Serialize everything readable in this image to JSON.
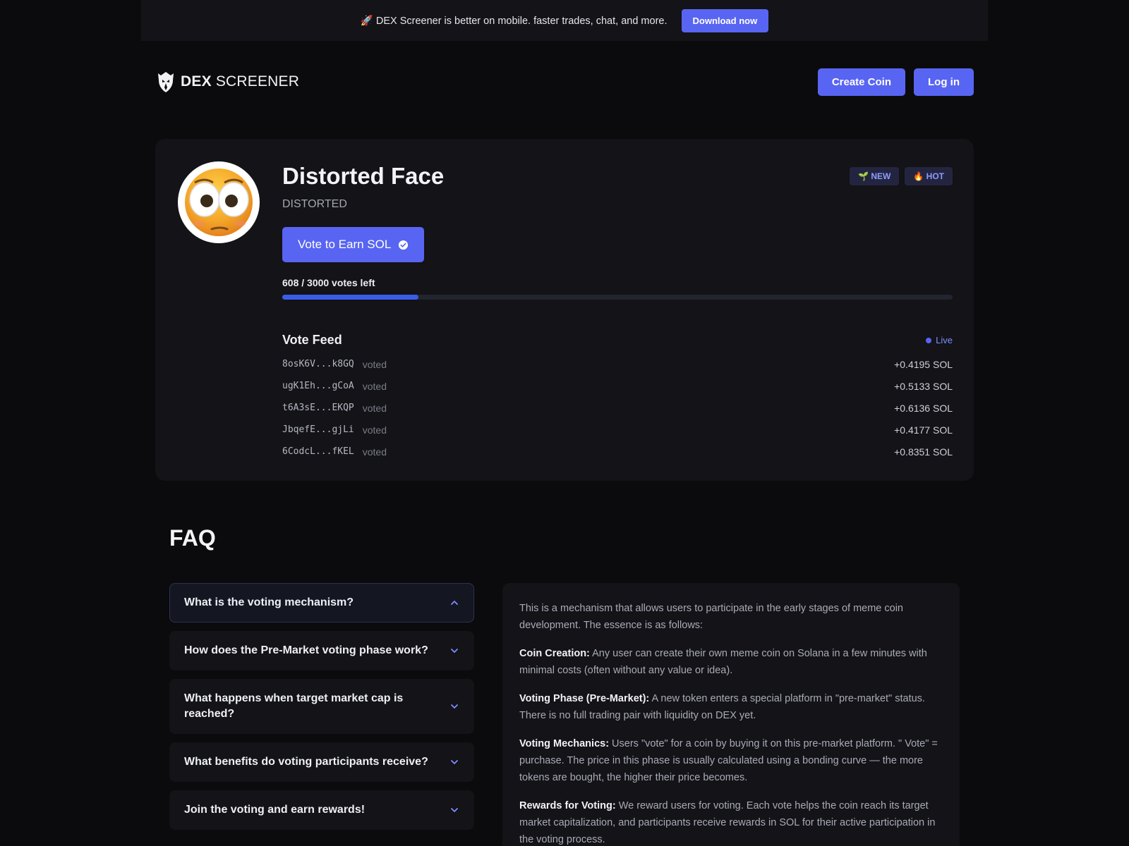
{
  "banner": {
    "text": "🚀 DEX Screener is better on mobile. faster trades, chat, and more.",
    "button": "Download now"
  },
  "header": {
    "logo_bold": "DEX",
    "logo_rest": "SCREENER",
    "create_coin": "Create Coin",
    "login": "Log in"
  },
  "coin": {
    "name": "Distorted Face",
    "ticker": "DISTORTED",
    "badges": [
      "🌱 NEW",
      "🔥 HOT"
    ],
    "vote_button": "Vote to Earn SOL",
    "votes_left": "608 / 3000 votes left",
    "progress_fraction": 0.2027
  },
  "feed": {
    "title": "Vote Feed",
    "live": "Live",
    "voted_label": "voted",
    "rows": [
      {
        "address": "8osK6V...k8GQ",
        "amount": "+0.4195 SOL"
      },
      {
        "address": "ugK1Eh...gCoA",
        "amount": "+0.5133 SOL"
      },
      {
        "address": "t6A3sE...EKQP",
        "amount": "+0.6136 SOL"
      },
      {
        "address": "JbqefE...gjLi",
        "amount": "+0.4177 SOL"
      },
      {
        "address": "6CodcL...fKEL",
        "amount": "+0.8351 SOL"
      }
    ]
  },
  "faq": {
    "title": "FAQ",
    "items": [
      "What is the voting mechanism?",
      "How does the Pre-Market voting phase work?",
      "What happens when target market cap is reached?",
      "What benefits do voting participants receive?",
      "Join the voting and earn rewards!"
    ],
    "answer": {
      "intro": "This is a mechanism that allows users to participate in the early stages of meme coin development. The essence is as follows:",
      "points": [
        {
          "term": "Coin Creation:",
          "text": " Any user can create their own meme coin on Solana in a few minutes with minimal costs (often without any value or idea)."
        },
        {
          "term": "Voting Phase (Pre-Market):",
          "text": " A new token enters a special platform in \"pre-market\" status. There is no full trading pair with liquidity on DEX yet."
        },
        {
          "term": "Voting Mechanics:",
          "text": " Users \"vote\" for a coin by buying it on this pre-market platform. \" Vote\" = purchase. The price in this phase is usually calculated using a bonding curve — the more tokens are bought, the higher their price becomes."
        },
        {
          "term": "Rewards for Voting:",
          "text": " We reward users for voting. Each vote helps the coin reach its target market capitalization, and participants receive rewards in SOL for their active participation in the voting process."
        }
      ]
    }
  },
  "colors": {
    "accent": "#5865f2",
    "background": "#0b0b0d",
    "card": "#131318"
  }
}
